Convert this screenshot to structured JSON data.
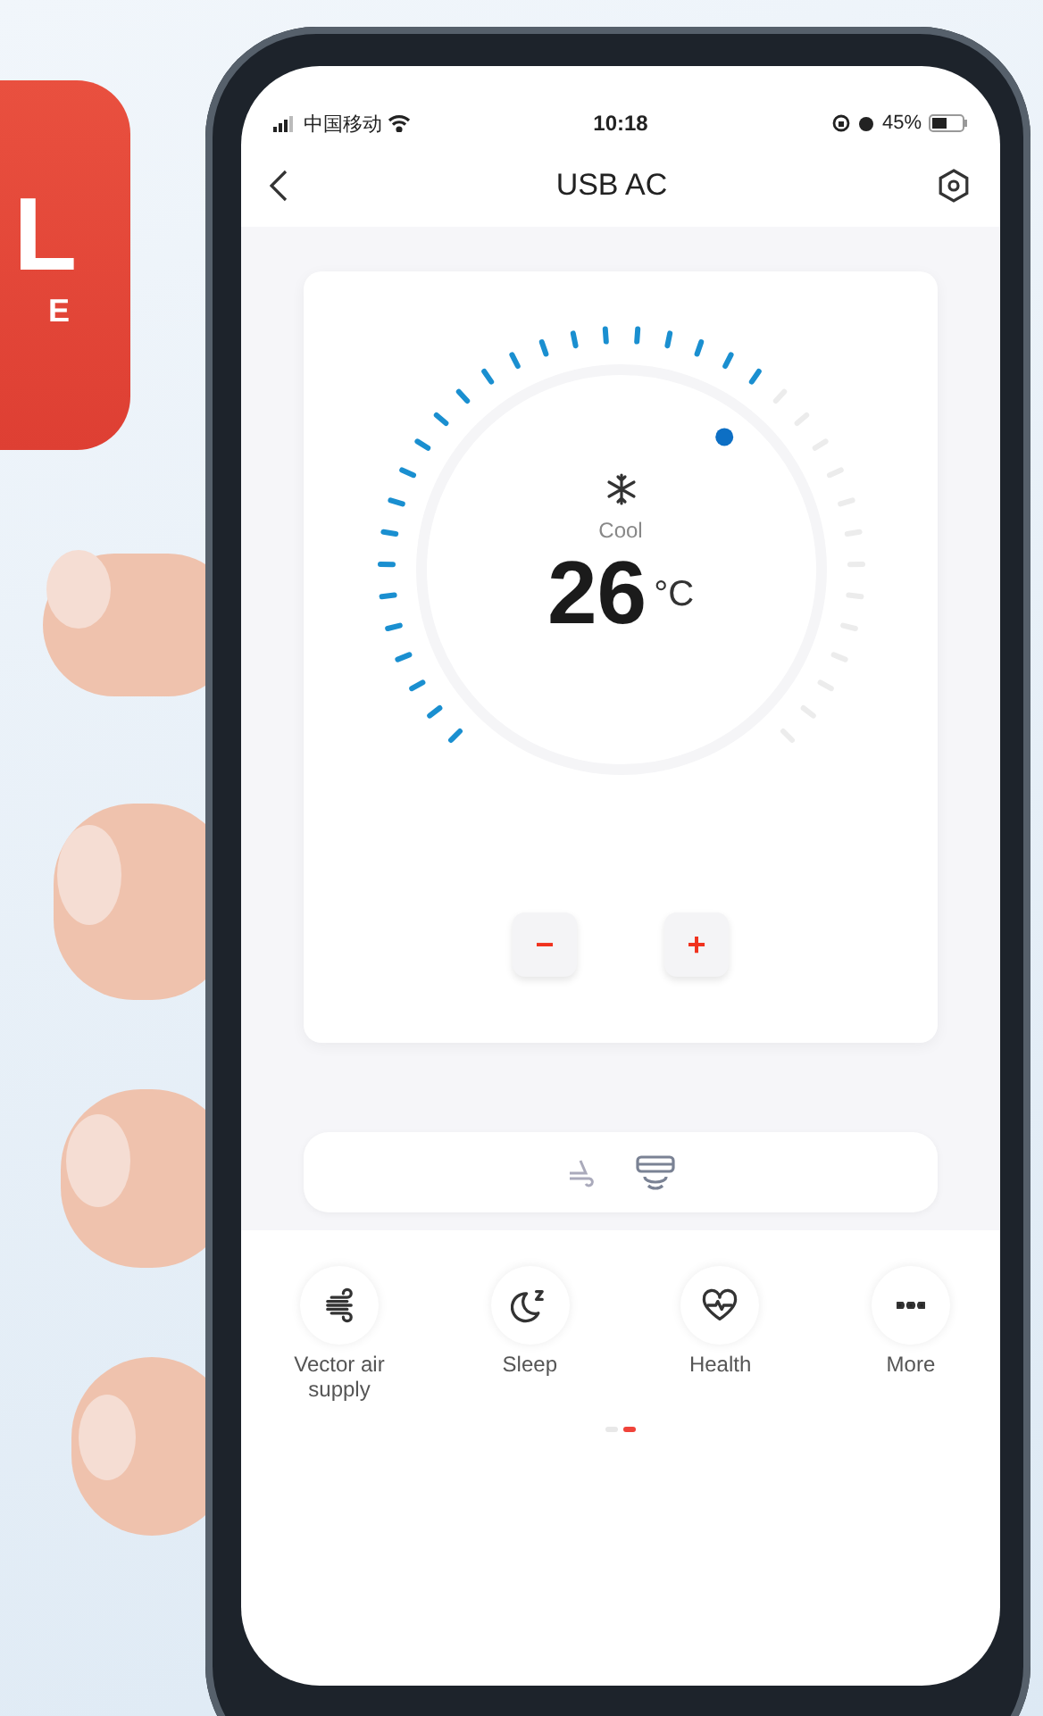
{
  "badge": {
    "texts": [
      "L",
      "E"
    ]
  },
  "status_bar": {
    "carrier": "中国移动",
    "time": "10:18",
    "battery": "45%"
  },
  "header": {
    "title": "USB AC"
  },
  "dial": {
    "mode": "Cool",
    "temperature": "26",
    "unit": "°C",
    "level": 0.64
  },
  "controls": [
    {
      "label": "−"
    },
    {
      "label": "+"
    }
  ],
  "features": [
    {
      "kind": "wind",
      "label": "Vector air supply"
    },
    {
      "kind": "sleep",
      "label": "Sleep"
    },
    {
      "kind": "health",
      "label": "Health"
    },
    {
      "kind": "more",
      "label": "More"
    }
  ],
  "page_dots": [
    {
      "selected": false
    },
    {
      "selected": true
    }
  ]
}
